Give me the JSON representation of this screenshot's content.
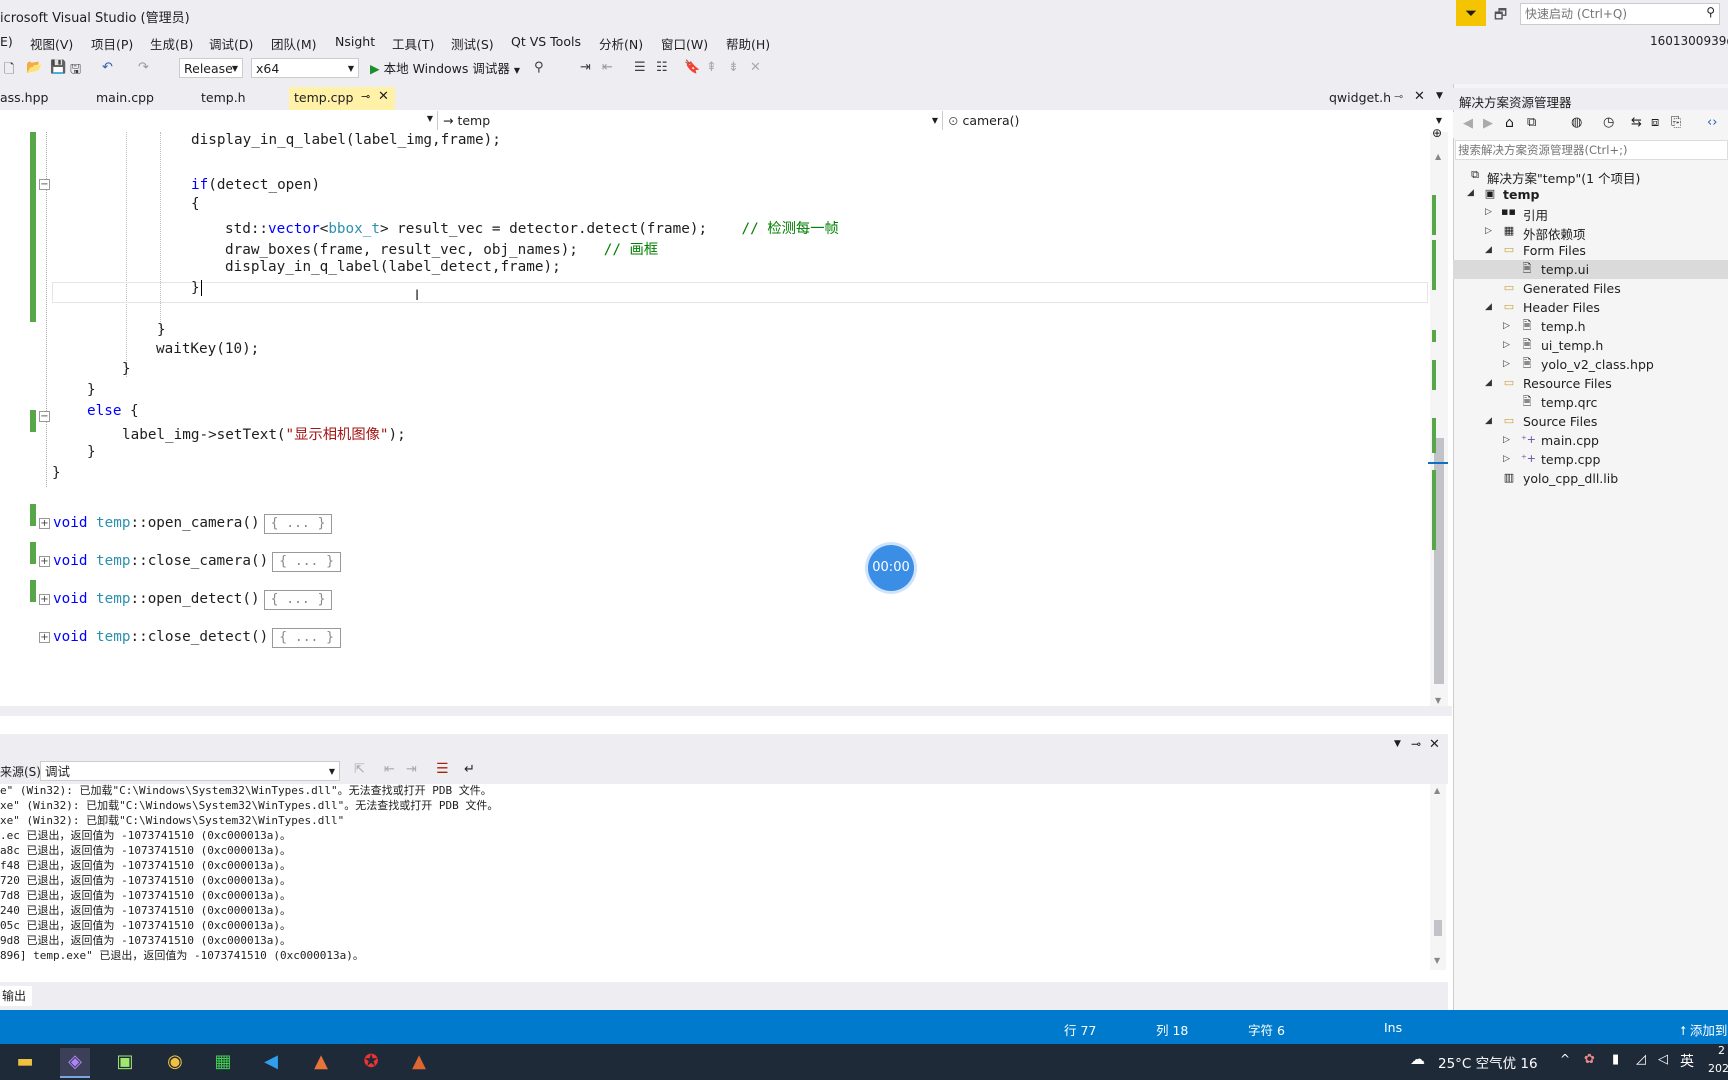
{
  "window": {
    "title": "icrosoft Visual Studio (管理员)",
    "quick_launch_placeholder": "快速启动 (Ctrl+Q)",
    "user": "1601300939@"
  },
  "menu": [
    "E)",
    "视图(V)",
    "项目(P)",
    "生成(B)",
    "调试(D)",
    "团队(M)",
    "Nsight",
    "工具(T)",
    "测试(S)",
    "Qt VS Tools",
    "分析(N)",
    "窗口(W)",
    "帮助(H)"
  ],
  "toolbar": {
    "config": "Release",
    "platform": "x64",
    "debugger": "本地 Windows 调试器"
  },
  "tabs": [
    {
      "label": "ass.hpp"
    },
    {
      "label": "main.cpp"
    },
    {
      "label": "temp.h"
    },
    {
      "label": "temp.cpp",
      "active": true
    },
    {
      "label": "qwidget.h"
    }
  ],
  "navbar": {
    "scope": "→ temp",
    "member": "camera()"
  },
  "code": {
    "l1": "display_in_q_label(label_img,frame);",
    "l2_kw": "if",
    "l2": "(detect_open)",
    "l3": "{",
    "l4_a": "std::",
    "l4_b": "vector",
    "l4_c": "<",
    "l4_d": "bbox_t",
    "l4_e": "> result_vec = detector.detect(frame);    ",
    "l4_cm": "// 检测每一帧",
    "l5": "draw_boxes(frame, result_vec, obj_names);   ",
    "l5_cm": "// 画框",
    "l6": "display_in_q_label(label_detect,frame);",
    "l7": "}",
    "l8": "}",
    "l9": "waitKey(10);",
    "l10": "}",
    "l11": "}",
    "l12_kw": "else",
    "l12": " {",
    "l13": "label_img->setText(",
    "l13_str": "\"显示相机图像\"",
    "l13_end": ");",
    "l14": "}",
    "l15": "}",
    "f1_kw": "void",
    "f1_cls": "temp",
    "f1_name": "::open_camera()",
    "f2_kw": "void",
    "f2_cls": "temp",
    "f2_name": "::close_camera()",
    "f3_kw": "void",
    "f3_cls": "temp",
    "f3_name": "::open_detect()",
    "f4_kw": "void",
    "f4_cls": "temp",
    "f4_name": "::close_detect()",
    "collapsed": "{ ... }"
  },
  "timer": "00:00",
  "output": {
    "source_label": "来源(S):",
    "source_value": "调试",
    "lines": [
      "e\" (Win32): 已加载\"C:\\Windows\\System32\\WinTypes.dll\"。无法查找或打开 PDB 文件。",
      "xe\" (Win32): 已加载\"C:\\Windows\\System32\\WinTypes.dll\"。无法查找或打开 PDB 文件。",
      "xe\" (Win32): 已卸载\"C:\\Windows\\System32\\WinTypes.dll\"",
      ".ec 已退出，返回值为 -1073741510 (0xc000013a)。",
      "a8c 已退出，返回值为 -1073741510 (0xc000013a)。",
      "f48 已退出，返回值为 -1073741510 (0xc000013a)。",
      "720 已退出，返回值为 -1073741510 (0xc000013a)。",
      "7d8 已退出，返回值为 -1073741510 (0xc000013a)。",
      "240 已退出，返回值为 -1073741510 (0xc000013a)。",
      "05c 已退出，返回值为 -1073741510 (0xc000013a)。",
      "9d8 已退出，返回值为 -1073741510 (0xc000013a)。",
      "896] temp.exe\" 已退出，返回值为 -1073741510 (0xc000013a)。"
    ],
    "tab": "输出"
  },
  "status": {
    "line": "行 77",
    "col": "列 18",
    "char": "字符 6",
    "mode": "Ins",
    "right": "添加到"
  },
  "solution": {
    "title": "解决方案资源管理器",
    "search_placeholder": "搜索解决方案资源管理器(Ctrl+;)",
    "root": "解决方案\"temp\"(1 个项目)",
    "project": "temp",
    "items": [
      {
        "label": "引用"
      },
      {
        "label": "外部依赖项"
      },
      {
        "label": "Form Files"
      },
      {
        "label": "temp.ui"
      },
      {
        "label": "Generated Files"
      },
      {
        "label": "Header Files"
      },
      {
        "label": "temp.h"
      },
      {
        "label": "ui_temp.h"
      },
      {
        "label": "yolo_v2_class.hpp"
      },
      {
        "label": "Resource Files"
      },
      {
        "label": "temp.qrc"
      },
      {
        "label": "Source Files"
      },
      {
        "label": "main.cpp"
      },
      {
        "label": "temp.cpp"
      },
      {
        "label": "yolo_cpp_dll.lib"
      }
    ]
  },
  "taskbar": {
    "weather": "25°C  空气优 16",
    "ime": "英",
    "time_partial": "2",
    "date_partial": "202"
  }
}
